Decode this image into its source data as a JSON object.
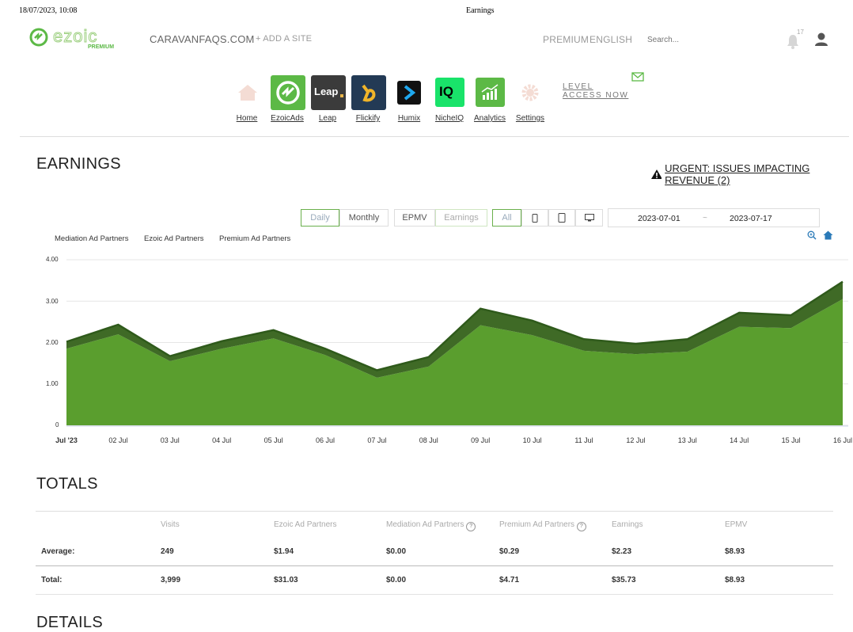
{
  "print_header": {
    "datetime": "18/07/2023, 10:08",
    "title": "Earnings"
  },
  "topnav": {
    "logo_text": "ezoic",
    "logo_badge": "PREMIUM",
    "site": "CARAVANFAQS.COM",
    "add_site": "+ ADD A SITE",
    "premium": "PREMIUM",
    "language": "ENGLISH",
    "search_placeholder": "Search...",
    "notification_count": "17"
  },
  "apps": [
    {
      "label": "Home",
      "icon": "home-icon"
    },
    {
      "label": "EzoicAds",
      "icon": "ezoicads-icon",
      "color": "#5cb946"
    },
    {
      "label": "Leap",
      "icon": "leap-icon",
      "color": "#3b3b3b",
      "text": "Leap"
    },
    {
      "label": "Flickify",
      "icon": "flickify-icon",
      "color": "#233a55"
    },
    {
      "label": "Humix",
      "icon": "humix-icon",
      "color": "#111111"
    },
    {
      "label": "NicheIQ",
      "icon": "nicheiq-icon",
      "color": "#19e36a",
      "text": "IQ"
    },
    {
      "label": "Analytics",
      "icon": "analytics-icon",
      "color": "#5cb946"
    },
    {
      "label": "Settings",
      "icon": "gear-icon"
    }
  ],
  "level_access": {
    "line1": "LEVEL",
    "line2": "ACCESS NOW"
  },
  "earnings": {
    "title": "EARNINGS",
    "urgent": "URGENT: ISSUES IMPACTING REVENUE (2)"
  },
  "controls": {
    "daily": "Daily",
    "monthly": "Monthly",
    "epmv": "EPMV",
    "earnings": "Earnings",
    "all": "All",
    "date_from": "2023-07-01",
    "date_sep": "~",
    "date_to": "2023-07-17"
  },
  "chart_data": {
    "type": "area",
    "stacked": true,
    "legend": [
      "Mediation Ad Partners",
      "Ezoic Ad Partners",
      "Premium Ad Partners"
    ],
    "categories": [
      "Jul '23",
      "02 Jul",
      "03 Jul",
      "04 Jul",
      "05 Jul",
      "06 Jul",
      "07 Jul",
      "08 Jul",
      "09 Jul",
      "10 Jul",
      "11 Jul",
      "12 Jul",
      "13 Jul",
      "14 Jul",
      "15 Jul",
      "16 Jul"
    ],
    "yticks": [
      "4.00",
      "3.00",
      "2.00",
      "1.00",
      "0"
    ],
    "ylim": [
      0,
      4
    ],
    "series": [
      {
        "name": "Mediation Ad Partners",
        "color": "#8fc46e",
        "values": [
          0,
          0,
          0,
          0,
          0,
          0,
          0,
          0,
          0,
          0,
          0,
          0,
          0,
          0,
          0,
          0
        ]
      },
      {
        "name": "Ezoic Ad Partners",
        "color": "#5a9e2e",
        "values": [
          1.85,
          2.2,
          1.55,
          1.85,
          2.1,
          1.7,
          1.15,
          1.42,
          2.42,
          2.18,
          1.8,
          1.72,
          1.78,
          2.38,
          2.35,
          3.05
        ]
      },
      {
        "name": "Premium Ad Partners",
        "color": "#3f6a26",
        "values": [
          0.17,
          0.23,
          0.12,
          0.18,
          0.2,
          0.15,
          0.18,
          0.23,
          0.4,
          0.35,
          0.28,
          0.25,
          0.3,
          0.34,
          0.31,
          0.42
        ]
      }
    ]
  },
  "totals": {
    "title": "TOTALS",
    "headers": [
      "Visits",
      "Ezoic Ad Partners",
      "Mediation Ad Partners",
      "Premium Ad Partners",
      "Earnings",
      "EPMV"
    ],
    "rows": [
      {
        "label": "Average:",
        "values": [
          "249",
          "$1.94",
          "$0.00",
          "$0.29",
          "$2.23",
          "$8.93"
        ]
      },
      {
        "label": "Total:",
        "values": [
          "3,999",
          "$31.03",
          "$0.00",
          "$4.71",
          "$35.73",
          "$8.93"
        ]
      }
    ]
  },
  "details": {
    "title": "DETAILS"
  }
}
